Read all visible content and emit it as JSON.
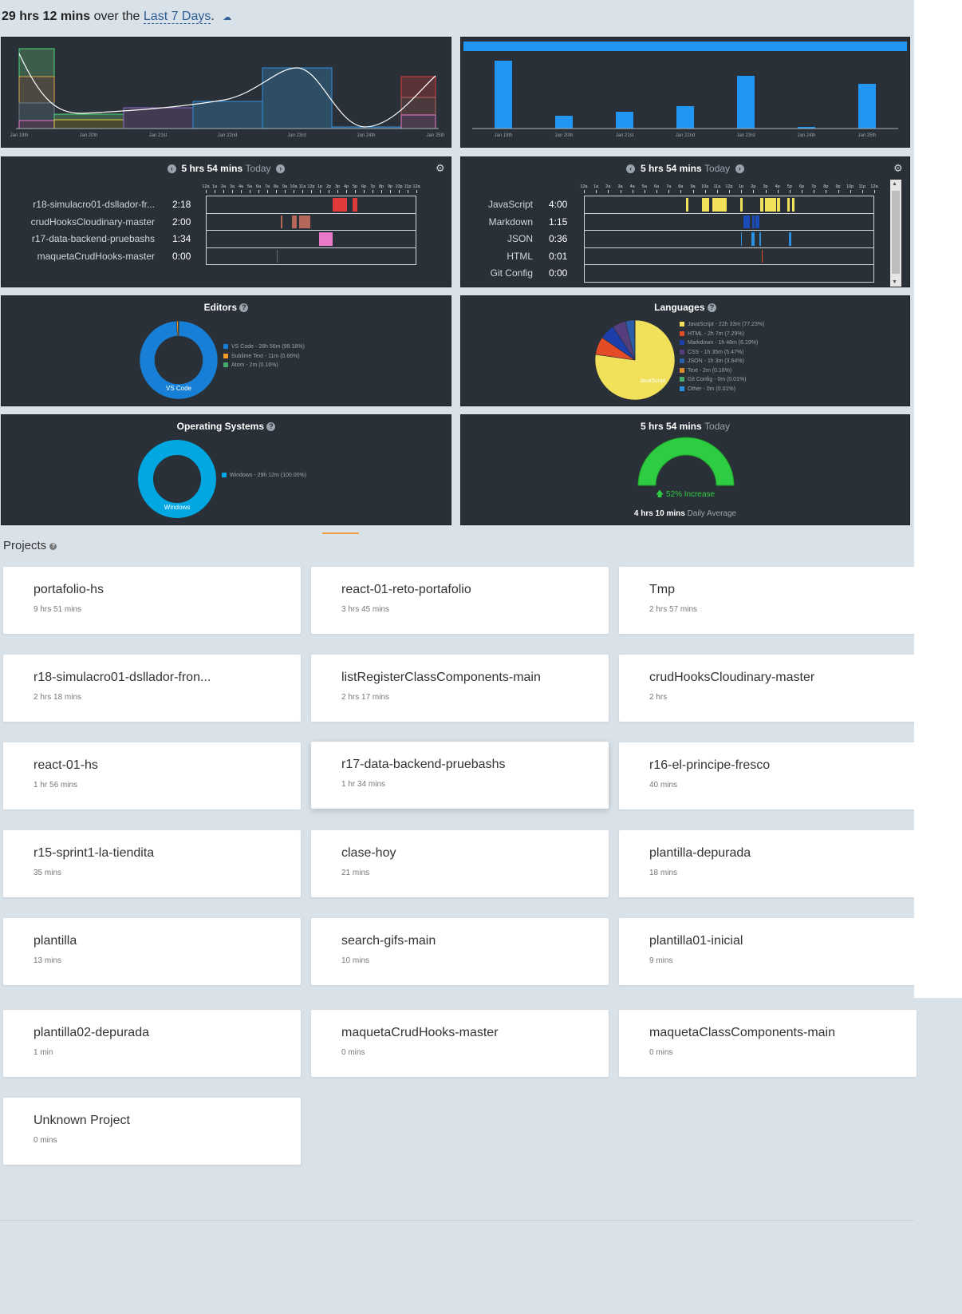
{
  "header": {
    "total": "29 hrs 12 mins",
    "middle": "over the",
    "range": "Last 7 Days",
    "dot": "."
  },
  "stack_chart": {
    "dates": [
      "Jan 19th",
      "Jan 20th",
      "Jan 21st",
      "Jan 22nd",
      "Jan 23rd",
      "Jan 24th",
      "Jan 25th"
    ]
  },
  "daily_chart": {
    "dates": [
      "Jan 19th",
      "Jan 20th",
      "Jan 21st",
      "Jan 22nd",
      "Jan 23rd",
      "Jan 24th",
      "Jan 25th"
    ]
  },
  "projects_timeline": {
    "total": "5 hrs 54 mins",
    "suffix": "Today",
    "hours": [
      "12a",
      "1a",
      "2a",
      "3a",
      "4a",
      "5a",
      "6a",
      "7a",
      "8a",
      "9a",
      "10a",
      "11a",
      "12p",
      "1p",
      "2p",
      "3p",
      "4p",
      "5p",
      "6p",
      "7p",
      "8p",
      "9p",
      "10p",
      "11p",
      "12a"
    ],
    "rows": [
      {
        "name": "r18-simulacro01-dsllador-fr...",
        "time": "2:18",
        "color": "#e03b3b"
      },
      {
        "name": "crudHooksCloudinary-master",
        "time": "2:00",
        "color": "#b5685a"
      },
      {
        "name": "r17-data-backend-pruebashs",
        "time": "1:34",
        "color": "#e879c8"
      },
      {
        "name": "maquetaCrudHooks-master",
        "time": "0:00",
        "color": "#6a6a6a"
      }
    ]
  },
  "languages_timeline": {
    "total": "5 hrs 54 mins",
    "suffix": "Today",
    "hours": [
      "12a",
      "1a",
      "2a",
      "3a",
      "4a",
      "5a",
      "6a",
      "7a",
      "8a",
      "9a",
      "10a",
      "11a",
      "12p",
      "1p",
      "2p",
      "3p",
      "4p",
      "5p",
      "6p",
      "7p",
      "8p",
      "9p",
      "10p",
      "11p",
      "12a"
    ],
    "rows": [
      {
        "name": "JavaScript",
        "time": "4:00",
        "color": "#f1e05a"
      },
      {
        "name": "Markdown",
        "time": "1:15",
        "color": "#1b4bb8"
      },
      {
        "name": "JSON",
        "time": "0:36",
        "color": "#2d8fe0"
      },
      {
        "name": "HTML",
        "time": "0:01",
        "color": "#e34c26"
      },
      {
        "name": "Git Config",
        "time": "0:00",
        "color": "#888888"
      }
    ]
  },
  "editors": {
    "title": "Editors",
    "center_label": "VS Code",
    "items": [
      {
        "label": "VS Code - 28h 56m (99.18%)",
        "color": "#1780d6",
        "pct": 99.18
      },
      {
        "label": "Sublime Text - 11m (0.66%)",
        "color": "#f59b23",
        "pct": 0.66
      },
      {
        "label": "Atom - 2m (0.16%)",
        "color": "#49a86e",
        "pct": 0.16
      }
    ]
  },
  "languages": {
    "title": "Languages",
    "center_label": "JavaScript",
    "items": [
      {
        "label": "JavaScript - 22h 33m (77.23%)",
        "color": "#f1e05a",
        "pct": 77.23
      },
      {
        "label": "HTML - 2h 7m (7.29%)",
        "color": "#e34c26",
        "pct": 7.29
      },
      {
        "label": "Markdown - 1h 48m (6.19%)",
        "color": "#1b3ea8",
        "pct": 6.19
      },
      {
        "label": "CSS - 1h 35m (5.47%)",
        "color": "#563d7c",
        "pct": 5.47
      },
      {
        "label": "JSON - 1h 3m (3.64%)",
        "color": "#2b5ea8",
        "pct": 3.64
      },
      {
        "label": "Text - 2m (0.16%)",
        "color": "#d98c2b",
        "pct": 0.16
      },
      {
        "label": "Git Config - 0m (0.01%)",
        "color": "#49a86e",
        "pct": 0.01
      },
      {
        "label": "Other - 0m (0.01%)",
        "color": "#2d8fe0",
        "pct": 0.01
      }
    ]
  },
  "os": {
    "title": "Operating Systems",
    "center_label": "Windows",
    "items": [
      {
        "label": "Windows - 29h 12m (100.00%)",
        "color": "#00a7e1",
        "pct": 100
      }
    ]
  },
  "today": {
    "total": "5 hrs 54 mins",
    "suffix": "Today",
    "increase": "52% Increase",
    "increase_fraction": 0.52,
    "avg": "4 hrs 10 mins",
    "avg_suffix": "Daily Average"
  },
  "projects": {
    "title": "Projects",
    "items": [
      {
        "name": "portafolio-hs",
        "time": "9 hrs 51 mins"
      },
      {
        "name": "react-01-reto-portafolio",
        "time": "3 hrs 45 mins"
      },
      {
        "name": "Tmp",
        "time": "2 hrs 57 mins"
      },
      {
        "name": "r18-simulacro01-dsllador-fron...",
        "time": "2 hrs 18 mins"
      },
      {
        "name": "listRegisterClassComponents-main",
        "time": "2 hrs 17 mins"
      },
      {
        "name": "crudHooksCloudinary-master",
        "time": "2 hrs"
      },
      {
        "name": "react-01-hs",
        "time": "1 hr 56 mins"
      },
      {
        "name": "r17-data-backend-pruebashs",
        "time": "1 hr 34 mins"
      },
      {
        "name": "r16-el-principe-fresco",
        "time": "40 mins"
      },
      {
        "name": "r15-sprint1-la-tiendita",
        "time": "35 mins"
      },
      {
        "name": "clase-hoy",
        "time": "21 mins"
      },
      {
        "name": "plantilla-depurada",
        "time": "18 mins"
      },
      {
        "name": "plantilla",
        "time": "13 mins"
      },
      {
        "name": "search-gifs-main",
        "time": "10 mins"
      },
      {
        "name": "plantilla01-inicial",
        "time": "9 mins"
      },
      {
        "name": "plantilla02-depurada",
        "time": "1 min"
      },
      {
        "name": "maquetaCrudHooks-master",
        "time": "0 mins"
      },
      {
        "name": "maquetaClassComponents-main",
        "time": "0 mins"
      },
      {
        "name": "Unknown Project",
        "time": "0 mins"
      }
    ]
  }
}
